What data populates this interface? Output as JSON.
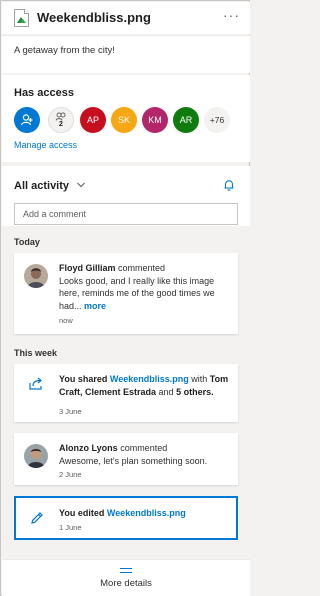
{
  "header": {
    "title": "Weekendbliss.png",
    "more_label": "···"
  },
  "description": "A getaway from the city!",
  "access": {
    "title": "Has access",
    "manage_label": "Manage access",
    "group_count": "2",
    "avatars": [
      {
        "initials": "AP",
        "color": "#c50f1f"
      },
      {
        "initials": "SK",
        "color": "#f7a614"
      },
      {
        "initials": "KM",
        "color": "#b4266a"
      },
      {
        "initials": "AR",
        "color": "#107c10"
      }
    ],
    "overflow": "+76",
    "colors": {
      "owner": "#0078d4",
      "group": "#f3f2f1"
    }
  },
  "activity": {
    "title": "All activity",
    "comment_placeholder": "Add a comment",
    "today_label": "Today",
    "week_label": "This week",
    "items": [
      {
        "actor": "Floyd Gilliam",
        "verb": "commented",
        "body": "Looks good, and I really like this image here, reminds me of the good times we had...",
        "more": "more",
        "time": "now"
      },
      {
        "prefix": "You shared",
        "file": "Weekendbliss.png",
        "mid": "with",
        "people": "Tom Craft, Clement Estrada",
        "and": "and",
        "others": "5 others.",
        "time": "3 June",
        "icon": "share-icon"
      },
      {
        "actor": "Alonzo Lyons",
        "verb": "commented",
        "body": "Awesome, let's plan something soon.",
        "time": "2 June"
      },
      {
        "prefix": "You edited",
        "file": "Weekendbliss.png",
        "time": "1 June",
        "icon": "edit-icon"
      }
    ]
  },
  "footer": {
    "more_details": "More details"
  },
  "accent": "#0078d4"
}
